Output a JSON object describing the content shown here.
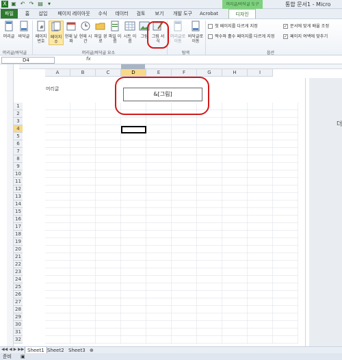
{
  "title_bar": {
    "doc_title": "통합 문서1 - Micro",
    "contextual_title": "머리글/바닥글 도구"
  },
  "tabs": [
    {
      "label": "파일"
    },
    {
      "label": "홈"
    },
    {
      "label": "삽입"
    },
    {
      "label": "페이지 레이아웃"
    },
    {
      "label": "수식"
    },
    {
      "label": "데이터"
    },
    {
      "label": "검토"
    },
    {
      "label": "보기"
    },
    {
      "label": "개발 도구"
    },
    {
      "label": "Acrobat"
    },
    {
      "label": "디자인"
    }
  ],
  "ribbon": {
    "buttons": [
      {
        "label": "머리글",
        "icon": "header-icon"
      },
      {
        "label": "바닥글",
        "icon": "footer-icon"
      },
      {
        "label": "페이지 번호",
        "icon": "page-number-icon"
      },
      {
        "label": "페이지 수",
        "icon": "page-count-icon"
      },
      {
        "label": "현재 날짜",
        "icon": "date-icon"
      },
      {
        "label": "현재 시간",
        "icon": "time-icon"
      },
      {
        "label": "파일 경로",
        "icon": "file-path-icon"
      },
      {
        "label": "파일 이름",
        "icon": "file-name-icon"
      },
      {
        "label": "시트 이름",
        "icon": "sheet-name-icon"
      },
      {
        "label": "그림",
        "icon": "picture-icon"
      },
      {
        "label": "그림 서식",
        "icon": "format-picture-icon"
      },
      {
        "label": "머리글로 이동",
        "icon": "go-to-header-icon"
      },
      {
        "label": "바닥글로 이동",
        "icon": "go-to-footer-icon"
      }
    ],
    "groups": {
      "header_footer": "머리글/바닥글",
      "elements": "머리글/바닥글 요소",
      "navigation": "탐색",
      "options": "옵션"
    },
    "options": [
      {
        "label": "첫 페이지를 다르게 지정",
        "checked": false
      },
      {
        "label": "짝수와 홀수 페이지를 다르게 지정",
        "checked": false
      },
      {
        "label": "문서에 맞게 배율 조정",
        "checked": true
      },
      {
        "label": "페이지 여백에 맞추기",
        "checked": true
      }
    ]
  },
  "formula_bar": {
    "name_box": "D4",
    "fx": "fx",
    "value": ""
  },
  "sheet": {
    "columns": [
      "A",
      "B",
      "C",
      "D",
      "E",
      "F",
      "G",
      "H",
      "I"
    ],
    "selected_column": "D",
    "rows": [
      "1",
      "2",
      "3",
      "4",
      "5",
      "6",
      "7",
      "8",
      "9",
      "10",
      "11",
      "12",
      "13",
      "14",
      "15",
      "16",
      "17",
      "18",
      "19",
      "20",
      "21",
      "22",
      "23",
      "24",
      "25",
      "26",
      "27",
      "28",
      "29",
      "30",
      "31",
      "32"
    ],
    "selected_row": "4",
    "header_label": "머리글",
    "header_content": "&[그림]",
    "side_text": "더"
  },
  "sheet_tabs": [
    {
      "label": "Sheet1",
      "active": true
    },
    {
      "label": "Sheet2",
      "active": false
    },
    {
      "label": "Sheet3",
      "active": false
    }
  ],
  "status": {
    "mode": "준비"
  }
}
